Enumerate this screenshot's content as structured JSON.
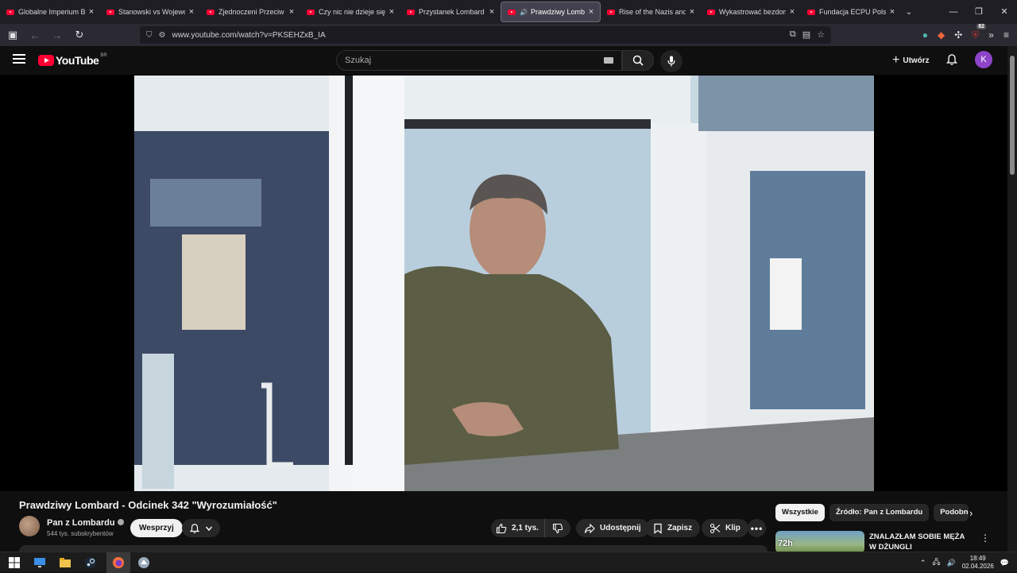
{
  "browser": {
    "tabs": [
      {
        "title": "Globalne Imperium Bezk"
      },
      {
        "title": "Stanowski vs Wojewódzk"
      },
      {
        "title": "Zjednoczeni Przeciw Ras"
      },
      {
        "title": "Czy nic nie dzieje się prz"
      },
      {
        "title": "Przystanek Lombard - Od"
      },
      {
        "title": "Prawdziwy Lombard",
        "active": true
      },
      {
        "title": "Rise of the Nazis and Ad"
      },
      {
        "title": "Wykastrować bezdomno"
      },
      {
        "title": "Fundacja ECPU Polska: b"
      }
    ],
    "url": "www.youtube.com/watch?v=PKSEHZxB_IA",
    "ext_badge": "82"
  },
  "youtube": {
    "logo_text": "YouTube",
    "region": "BR",
    "search_placeholder": "Szukaj",
    "create_label": "Utwórz",
    "avatar_letter": "K",
    "accent": "#ff0033"
  },
  "video": {
    "title": "Prawdziwy Lombard - Odcinek 342 \"Wyrozumiałość\"",
    "channel_name": "Pan z Lombardu",
    "subscribers": "544 tys. subskrybentów",
    "support_label": "Wesprzyj",
    "likes": "2,1 tys.",
    "share_label": "Udostępnij",
    "save_label": "Zapisz",
    "clip_label": "Klip"
  },
  "sidebar": {
    "chips": [
      "Wszystkie",
      "Źródło: Pan z Lombardu",
      "Podobne"
    ],
    "recommendation": {
      "title": "ZNALAZŁAM SOBIE MĘŻA W DŻUNGLI",
      "thumb_text": "72h"
    }
  },
  "taskbar": {
    "time": "18:49",
    "date": "02.04.2026"
  }
}
